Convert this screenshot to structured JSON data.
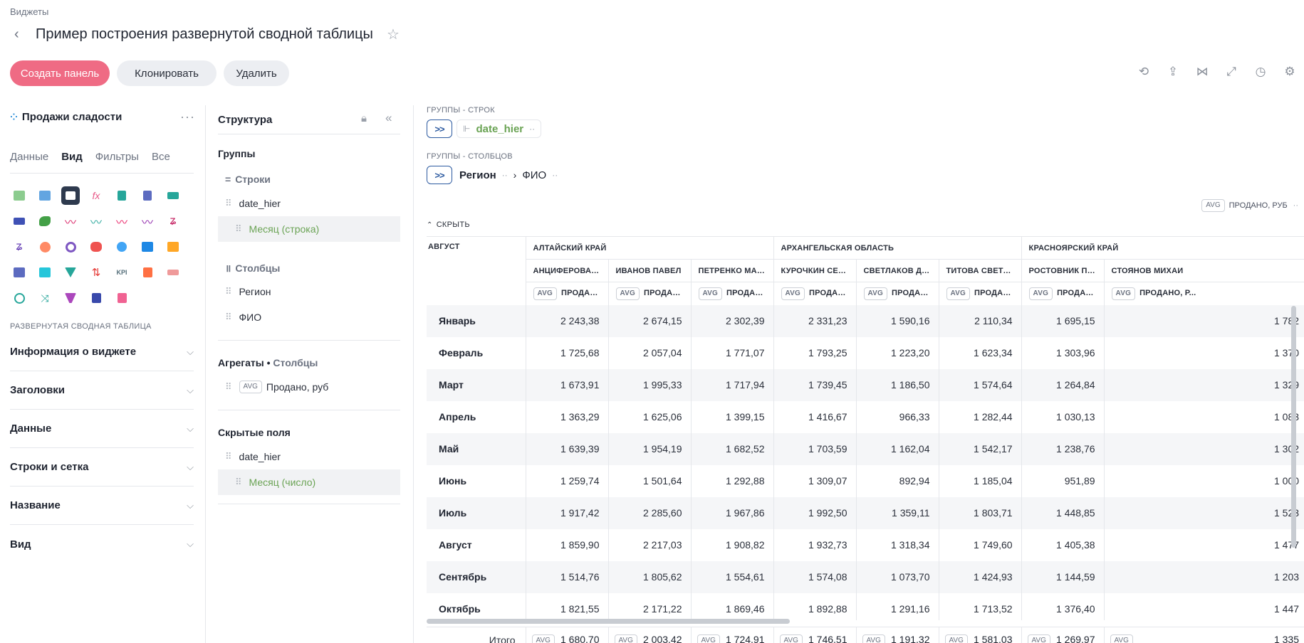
{
  "breadcrumb": "Виджеты",
  "page_title": "Пример построения развернутой сводной таблицы",
  "toolbar": {
    "create_panel": "Создать панель",
    "clone": "Клонировать",
    "delete": "Удалить",
    "icons": [
      "reset-icon",
      "upload-icon",
      "share-icon",
      "expand-icon",
      "history-icon",
      "settings-icon"
    ]
  },
  "left_panel": {
    "dataset_name": "Продажи сладости",
    "tabs": [
      "Данные",
      "Вид",
      "Фильтры",
      "Все"
    ],
    "active_tab": "Вид",
    "section_label": "РАЗВЕРНУТАЯ СВОДНАЯ ТАБЛИЦА",
    "accordions": [
      "Информация о виджете",
      "Заголовки",
      "Данные",
      "Строки и сетка",
      "Название",
      "Вид"
    ]
  },
  "structure_panel": {
    "title": "Структура",
    "groups_label": "Группы",
    "rows_label": "Строки",
    "row_fields": [
      "date_hier",
      "Месяц (строка)"
    ],
    "columns_label": "Столбцы",
    "column_fields": [
      "Регион",
      "ФИО"
    ],
    "aggregates_label": "Агрегаты",
    "aggregates_suffix": "Столбцы",
    "aggregate_field": {
      "func": "AVG",
      "name": "Продано, руб"
    },
    "hidden_label": "Скрытые поля",
    "hidden_fields": [
      "date_hier",
      "Месяц (число)"
    ]
  },
  "pivot": {
    "row_groups_label": "ГРУППЫ - СТРОК",
    "row_group_field": "date_hier",
    "col_groups_label": "ГРУППЫ - СТОЛБЦОВ",
    "col_group_fields": [
      "Регион",
      "ФИО"
    ],
    "legend": {
      "func": "AVG",
      "measure": "ПРОДАНО, РУБ"
    },
    "hide_label": "СКРЫТЬ",
    "corner_label": "АВГУСТ",
    "regions": [
      {
        "name": "АЛТАЙСКИЙ КРАЙ",
        "span": 3
      },
      {
        "name": "АРХАНГЕЛЬСКАЯ ОБЛАСТЬ",
        "span": 3
      },
      {
        "name": "КРАСНОЯРСКИЙ КРАЙ",
        "span": 2
      }
    ],
    "people": [
      "АНЦИФЕРОВА АЛЕ...",
      "ИВАНОВ ПАВЕЛ",
      "ПЕТРЕНКО МАРИЯ",
      "КУРОЧКИН СЕРГЕЙ",
      "СВЕТЛАКОВ ДМИТР...",
      "ТИТОВА СВЕТЛАНА",
      "РОСТОВНИК ПЕТР",
      "СТОЯНОВ МИХАИ"
    ],
    "measure_func": "AVG",
    "measure_header": "ПРОДАНО, Р...",
    "rows": [
      {
        "label": "Январь",
        "values": [
          "2 243,38",
          "2 674,15",
          "2 302,39",
          "2 331,23",
          "1 590,16",
          "2 110,34",
          "1 695,15",
          "1 782"
        ]
      },
      {
        "label": "Февраль",
        "values": [
          "1 725,68",
          "2 057,04",
          "1 771,07",
          "1 793,25",
          "1 223,20",
          "1 623,34",
          "1 303,96",
          "1 370"
        ]
      },
      {
        "label": "Март",
        "values": [
          "1 673,91",
          "1 995,33",
          "1 717,94",
          "1 739,45",
          "1 186,50",
          "1 574,64",
          "1 264,84",
          "1 329"
        ]
      },
      {
        "label": "Апрель",
        "values": [
          "1 363,29",
          "1 625,06",
          "1 399,15",
          "1 416,67",
          "966,33",
          "1 282,44",
          "1 030,13",
          "1 083"
        ]
      },
      {
        "label": "Май",
        "values": [
          "1 639,39",
          "1 954,19",
          "1 682,52",
          "1 703,59",
          "1 162,04",
          "1 542,17",
          "1 238,76",
          "1 302"
        ]
      },
      {
        "label": "Июнь",
        "values": [
          "1 259,74",
          "1 501,64",
          "1 292,88",
          "1 309,07",
          "892,94",
          "1 185,04",
          "951,89",
          "1 000"
        ]
      },
      {
        "label": "Июль",
        "values": [
          "1 917,42",
          "2 285,60",
          "1 967,86",
          "1 992,50",
          "1 359,11",
          "1 803,71",
          "1 448,85",
          "1 523"
        ]
      },
      {
        "label": "Август",
        "values": [
          "1 859,90",
          "2 217,03",
          "1 908,82",
          "1 932,73",
          "1 318,34",
          "1 749,60",
          "1 405,38",
          "1 477"
        ]
      },
      {
        "label": "Сентябрь",
        "values": [
          "1 514,76",
          "1 805,62",
          "1 554,61",
          "1 574,08",
          "1 073,70",
          "1 424,93",
          "1 144,59",
          "1 203"
        ]
      },
      {
        "label": "Октябрь",
        "values": [
          "1 821,55",
          "2 171,22",
          "1 869,46",
          "1 892,88",
          "1 291,16",
          "1 713,52",
          "1 376,40",
          "1 447"
        ]
      }
    ],
    "totals_label": "Итого",
    "totals": [
      "1 680,70",
      "2 003,42",
      "1 724,91",
      "1 746,51",
      "1 191,32",
      "1 581,03",
      "1 269,97",
      "1 335"
    ]
  }
}
